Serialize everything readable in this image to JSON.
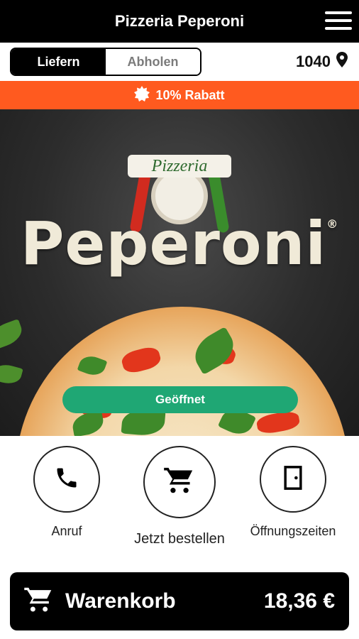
{
  "header": {
    "title": "Pizzeria Peperoni",
    "menu_icon": "hamburger-menu-icon"
  },
  "mode": {
    "options": [
      {
        "label": "Liefern",
        "active": true
      },
      {
        "label": "Abholen",
        "active": false
      }
    ],
    "zip": "1040",
    "zip_icon": "location-pin-icon"
  },
  "promo": {
    "label": "10% Rabatt",
    "icon": "badge-icon",
    "color": "#ff5a1f"
  },
  "hero": {
    "logo_banner": "Pizzeria",
    "logo_word": "Peperoni",
    "logo_mark": "®",
    "status": "Geöffnet",
    "status_color": "#1fa774"
  },
  "actions": [
    {
      "label": "Anruf",
      "icon": "phone-icon"
    },
    {
      "label": "Jetzt bestellen",
      "icon": "cart-icon"
    },
    {
      "label": "Öffnungszeiten",
      "icon": "door-icon"
    }
  ],
  "cart": {
    "label": "Warenkorb",
    "total": "18,36 €",
    "icon": "cart-icon"
  }
}
